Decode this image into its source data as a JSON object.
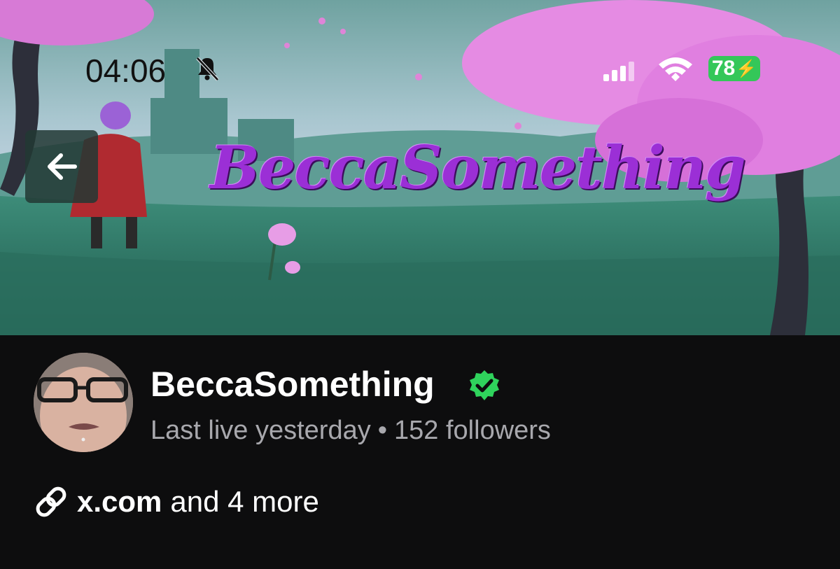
{
  "status_bar": {
    "time": "04:06",
    "icons": [
      "bell-slash-icon",
      "signal-bars-icon",
      "wifi-icon"
    ],
    "battery": "78"
  },
  "banner": {
    "title": "BeccaSomething",
    "back_icon": "arrow-left-icon"
  },
  "profile": {
    "display_name": "BeccaSomething",
    "verified_icon": "verified-badge-icon",
    "last_live": "Last live yesterday",
    "separator": "•",
    "followers": "152 followers"
  },
  "links": {
    "icon": "link-icon",
    "primary": "x.com",
    "more": "and 4 more"
  },
  "colors": {
    "background": "#0d0d0e",
    "verified": "#2fd35c",
    "muted_text": "#a8a8ad",
    "battery": "#34c759",
    "title_purple": "#9b2fd6"
  }
}
